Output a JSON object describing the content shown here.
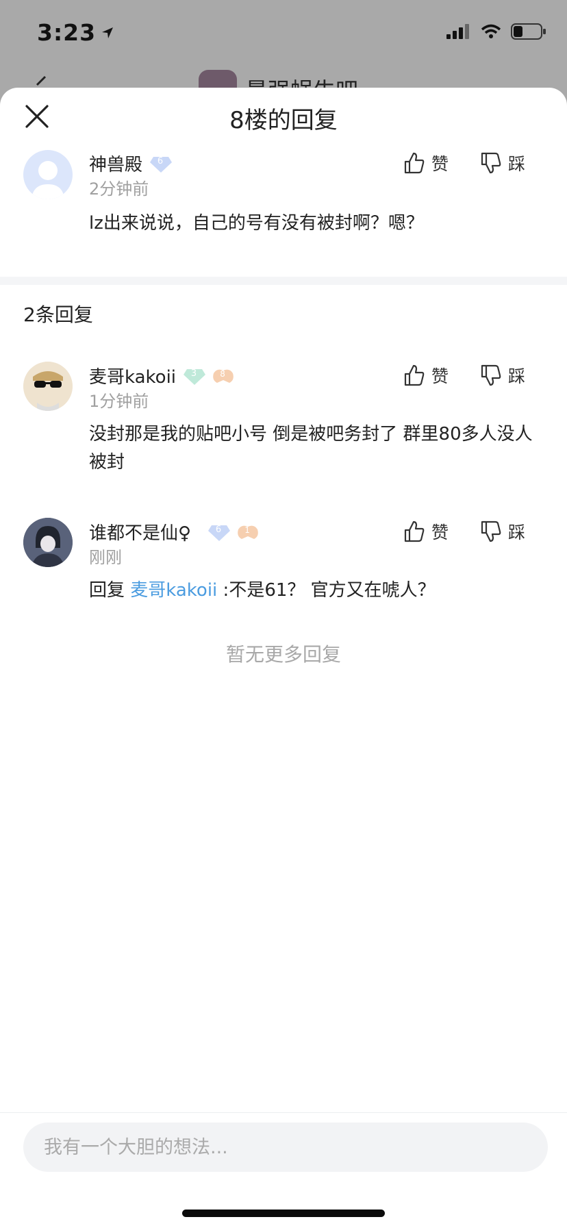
{
  "status_bar": {
    "time": "3:23"
  },
  "underlay": {
    "forum_title": "最强蜗牛吧"
  },
  "sheet": {
    "title": "8楼的回复"
  },
  "main_post": {
    "username": "神兽殿",
    "level": "6",
    "time": "2分钟前",
    "content": "lz出来说说，自己的号有没有被封啊？嗯？",
    "like_label": "赞",
    "dislike_label": "踩"
  },
  "reply_count": "2条回复",
  "replies": [
    {
      "username": "麦哥kakoii",
      "level": "3",
      "badge": "8",
      "time": "1分钟前",
      "content": "没封那是我的贴吧小号 倒是被吧务封了 群里80多人没人被封",
      "like_label": "赞",
      "dislike_label": "踩"
    },
    {
      "username": "谁都不是仙♀",
      "level": "6",
      "badge": "1",
      "time": "刚刚",
      "reply_prefix": "回复 ",
      "reply_to": "麦哥kakoii",
      "content": " :不是61？ 官方又在唬人？",
      "like_label": "赞",
      "dislike_label": "踩"
    }
  ],
  "no_more": "暂无更多回复",
  "input": {
    "placeholder": "我有一个大胆的想法..."
  },
  "colors": {
    "link": "#4b9ce0",
    "muted": "#a0a0a0",
    "divider": "#f4f5f7"
  }
}
